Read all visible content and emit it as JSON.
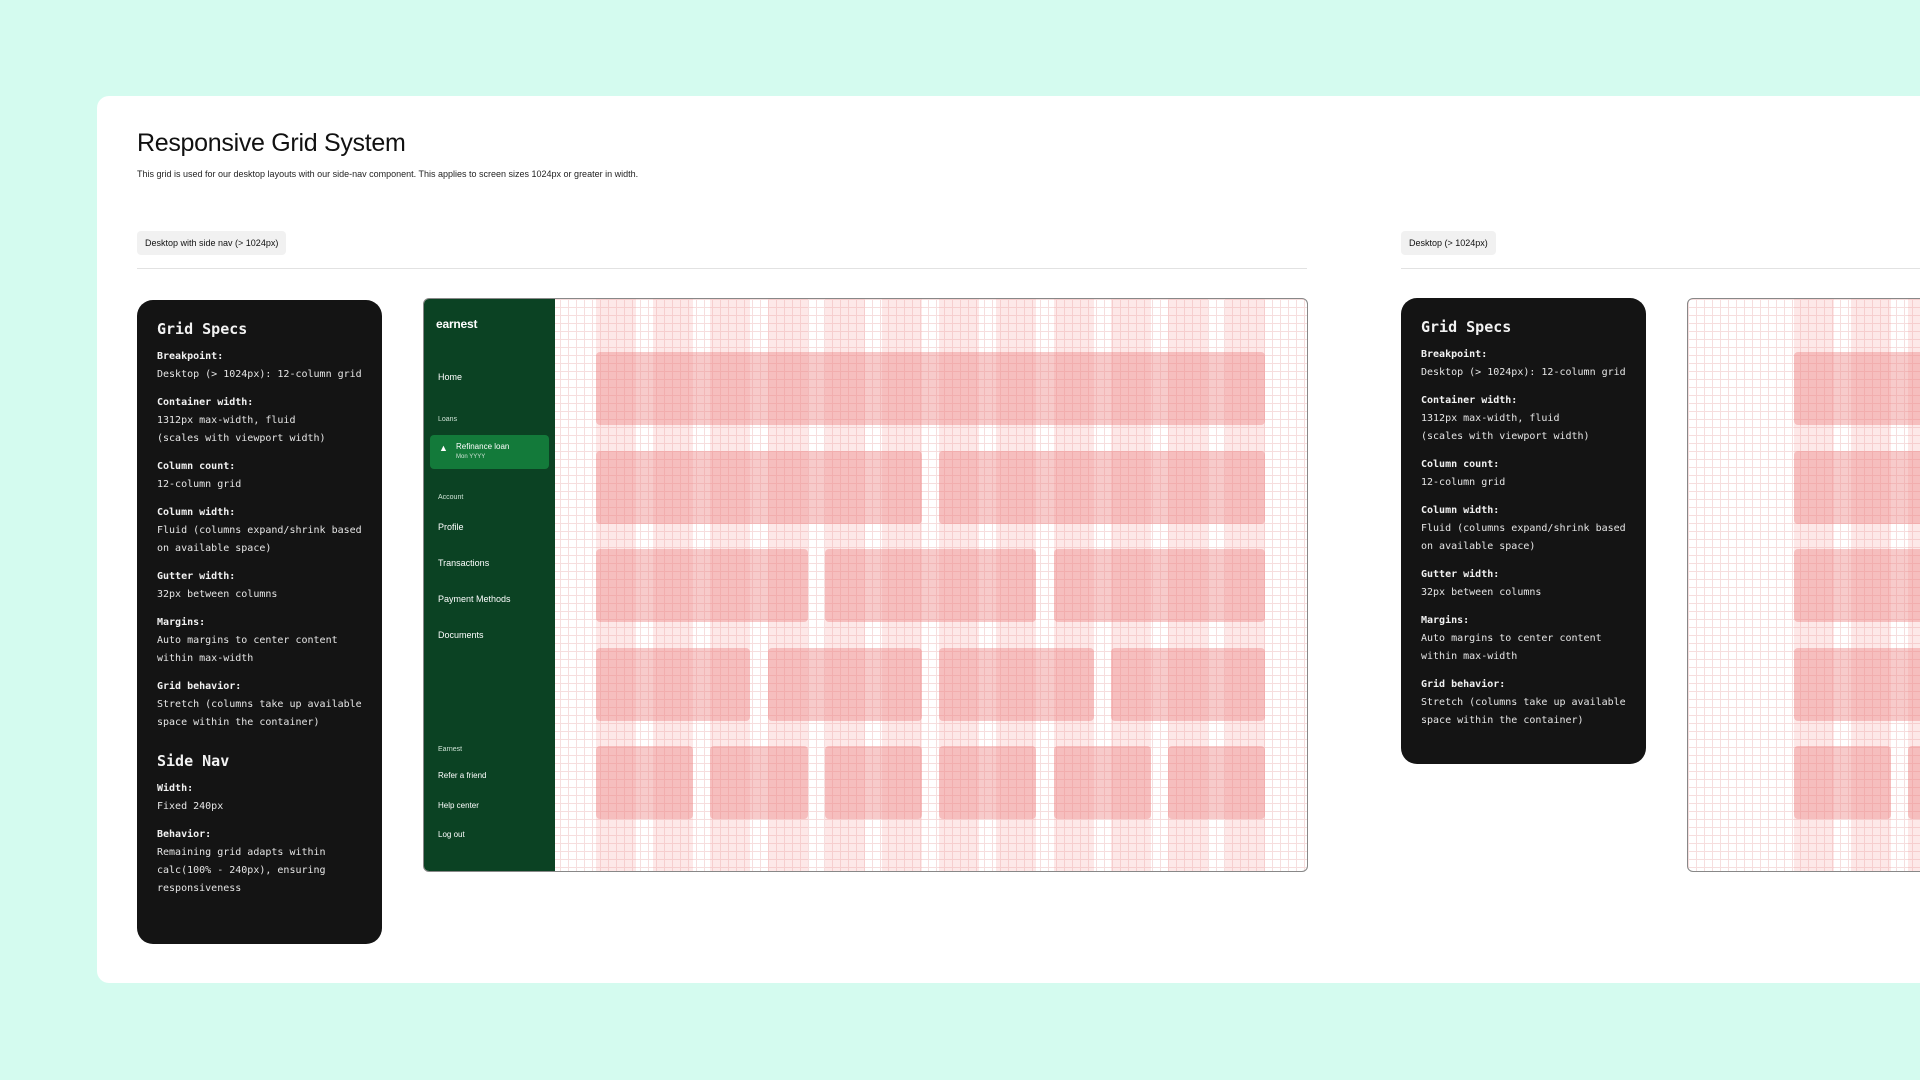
{
  "page": {
    "title": "Responsive Grid System",
    "subtitle": "This grid is used for our desktop layouts with our side-nav component. This applies to screen sizes 1024px or greater in width."
  },
  "variants": [
    {
      "tag": "Desktop with side nav (> 1024px)"
    },
    {
      "tag": "Desktop (> 1024px)"
    }
  ],
  "grid_specs": {
    "heading": "Grid Specs",
    "items": [
      {
        "label": "Breakpoint:",
        "value": "Desktop (> 1024px): 12-column grid"
      },
      {
        "label": "Container width:",
        "value": "1312px max-width, fluid\n(scales with viewport width)"
      },
      {
        "label": "Column count:",
        "value": "12-column grid"
      },
      {
        "label": "Column width:",
        "value": "Fluid (columns expand/shrink based\non available space)"
      },
      {
        "label": "Gutter width:",
        "value": "32px between columns"
      },
      {
        "label": "Margins:",
        "value": "Auto margins to center content\nwithin max-width"
      },
      {
        "label": "Grid behavior:",
        "value": "Stretch (columns take up available\nspace within the container)"
      }
    ]
  },
  "side_nav_specs": {
    "heading": "Side Nav",
    "items": [
      {
        "label": "Width:",
        "value": "Fixed 240px"
      },
      {
        "label": "Behavior:",
        "value": "Remaining grid adapts within\ncalc(100% - 240px), ensuring\nresponsiveness"
      }
    ]
  },
  "sidenav": {
    "logo": "earnest",
    "home": "Home",
    "loans_section": "Loans",
    "active_item": {
      "label": "Refinance loan",
      "sub": "Mon YYYY",
      "icon": "graduation-cap-icon"
    },
    "account_section": "Account",
    "profile": "Profile",
    "transactions": "Transactions",
    "payment_methods": "Payment Methods",
    "documents": "Documents",
    "earnest_section": "Earnest",
    "refer": "Refer a friend",
    "help": "Help center",
    "logout": "Log out"
  },
  "colors": {
    "background": "#d4fbef",
    "nav_green": "#0b4223",
    "nav_active": "#137a3a",
    "spec_card": "#141414",
    "grid_column": "#f49696"
  },
  "grid": {
    "columns": 12,
    "rows": [
      1,
      2,
      3,
      4,
      6
    ]
  }
}
